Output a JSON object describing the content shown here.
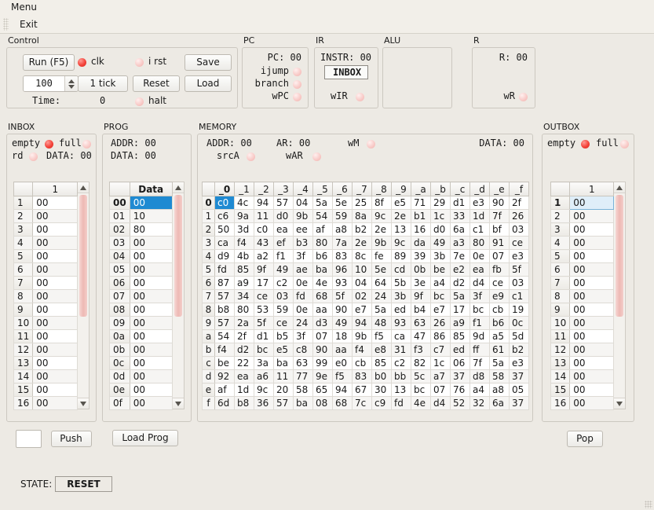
{
  "menu": {
    "items": [
      "Menu"
    ]
  },
  "toolbar": {
    "items": [
      "Exit"
    ]
  },
  "control": {
    "label": "Control",
    "run_label": "Run (F5)",
    "speed_value": "100",
    "tick_label": "1 tick",
    "reset_label": "Reset",
    "save_label": "Save",
    "load_label": "Load",
    "clk_label": "clk",
    "clk_state": "on",
    "irst_label": "i rst",
    "irst_state": "off",
    "halt_label": "halt",
    "halt_state": "off",
    "time_label": "Time:",
    "time_value": "0"
  },
  "pc": {
    "label": "PC",
    "pc_text": "PC: 00",
    "ijump_label": "ijump",
    "ijump_state": "off",
    "branch_label": "branch",
    "branch_state": "off",
    "wpc_label": "wPC",
    "wpc_state": "off"
  },
  "ir": {
    "label": "IR",
    "instr_text": "INSTR: 00",
    "instr_value": "INBOX",
    "wir_label": "wIR",
    "wir_state": "off"
  },
  "alu": {
    "label": "ALU"
  },
  "r": {
    "label": "R",
    "r_text": "R: 00",
    "wr_label": "wR",
    "wr_state": "off"
  },
  "inbox": {
    "label": "INBOX",
    "empty_label": "empty",
    "empty_state": "on",
    "full_label": "full",
    "full_state": "off",
    "rd_label": "rd",
    "rd_state": "off",
    "data_text": "DATA: 00",
    "column_header": "1",
    "rows": [
      {
        "idx": "1",
        "val": "00"
      },
      {
        "idx": "2",
        "val": "00"
      },
      {
        "idx": "3",
        "val": "00"
      },
      {
        "idx": "4",
        "val": "00"
      },
      {
        "idx": "5",
        "val": "00"
      },
      {
        "idx": "6",
        "val": "00"
      },
      {
        "idx": "7",
        "val": "00"
      },
      {
        "idx": "8",
        "val": "00"
      },
      {
        "idx": "9",
        "val": "00"
      },
      {
        "idx": "10",
        "val": "00"
      },
      {
        "idx": "11",
        "val": "00"
      },
      {
        "idx": "12",
        "val": "00"
      },
      {
        "idx": "13",
        "val": "00"
      },
      {
        "idx": "14",
        "val": "00"
      },
      {
        "idx": "15",
        "val": "00"
      },
      {
        "idx": "16",
        "val": "00"
      }
    ],
    "push_input_value": "",
    "push_label": "Push"
  },
  "prog": {
    "label": "PROG",
    "addr_text": "ADDR: 00",
    "data_text": "DATA: 00",
    "column_header": "Data",
    "rows": [
      {
        "idx": "00",
        "val": "00",
        "selected": true
      },
      {
        "idx": "01",
        "val": "10"
      },
      {
        "idx": "02",
        "val": "80"
      },
      {
        "idx": "03",
        "val": "00"
      },
      {
        "idx": "04",
        "val": "00"
      },
      {
        "idx": "05",
        "val": "00"
      },
      {
        "idx": "06",
        "val": "00"
      },
      {
        "idx": "07",
        "val": "00"
      },
      {
        "idx": "08",
        "val": "00"
      },
      {
        "idx": "09",
        "val": "00"
      },
      {
        "idx": "0a",
        "val": "00"
      },
      {
        "idx": "0b",
        "val": "00"
      },
      {
        "idx": "0c",
        "val": "00"
      },
      {
        "idx": "0d",
        "val": "00"
      },
      {
        "idx": "0e",
        "val": "00"
      },
      {
        "idx": "0f",
        "val": "00"
      }
    ],
    "load_prog_label": "Load Prog"
  },
  "memory": {
    "label": "MEMORY",
    "addr_text": "ADDR: 00",
    "ar_text": "AR: 00",
    "wm_label": "wM",
    "wm_state": "off",
    "data_text": "DATA: 00",
    "srca_label": "srcA",
    "srca_state": "off",
    "war_label": "wAR",
    "war_state": "off",
    "columns": [
      "_0",
      "_1",
      "_2",
      "_3",
      "_4",
      "_5",
      "_6",
      "_7",
      "_8",
      "_9",
      "_a",
      "_b",
      "_c",
      "_d",
      "_e",
      "_f"
    ],
    "row_headers": [
      "0",
      "1",
      "2",
      "3",
      "4",
      "5",
      "6",
      "7",
      "8",
      "9",
      "a",
      "b",
      "c",
      "d",
      "e",
      "f"
    ],
    "selected_cell": {
      "row": 0,
      "col": 0
    },
    "cells": [
      [
        "c0",
        "4c",
        "94",
        "57",
        "04",
        "5a",
        "5e",
        "25",
        "8f",
        "e5",
        "71",
        "29",
        "d1",
        "e3",
        "90",
        "2f"
      ],
      [
        "c6",
        "9a",
        "11",
        "d0",
        "9b",
        "54",
        "59",
        "8a",
        "9c",
        "2e",
        "b1",
        "1c",
        "33",
        "1d",
        "7f",
        "26"
      ],
      [
        "50",
        "3d",
        "c0",
        "ea",
        "ee",
        "af",
        "a8",
        "b2",
        "2e",
        "13",
        "16",
        "d0",
        "6a",
        "c1",
        "bf",
        "03"
      ],
      [
        "ca",
        "f4",
        "43",
        "ef",
        "b3",
        "80",
        "7a",
        "2e",
        "9b",
        "9c",
        "da",
        "49",
        "a3",
        "80",
        "91",
        "ce"
      ],
      [
        "d9",
        "4b",
        "a2",
        "f1",
        "3f",
        "b6",
        "83",
        "8c",
        "fe",
        "89",
        "39",
        "3b",
        "7e",
        "0e",
        "07",
        "e3"
      ],
      [
        "fd",
        "85",
        "9f",
        "49",
        "ae",
        "ba",
        "96",
        "10",
        "5e",
        "cd",
        "0b",
        "be",
        "e2",
        "ea",
        "fb",
        "5f"
      ],
      [
        "87",
        "a9",
        "17",
        "c2",
        "0e",
        "4e",
        "93",
        "04",
        "64",
        "5b",
        "3e",
        "a4",
        "d2",
        "d4",
        "ce",
        "03"
      ],
      [
        "57",
        "34",
        "ce",
        "03",
        "fd",
        "68",
        "5f",
        "02",
        "24",
        "3b",
        "9f",
        "bc",
        "5a",
        "3f",
        "e9",
        "c1"
      ],
      [
        "b8",
        "80",
        "53",
        "59",
        "0e",
        "aa",
        "90",
        "e7",
        "5a",
        "ed",
        "b4",
        "e7",
        "17",
        "bc",
        "cb",
        "19"
      ],
      [
        "57",
        "2a",
        "5f",
        "ce",
        "24",
        "d3",
        "49",
        "94",
        "48",
        "93",
        "63",
        "26",
        "a9",
        "f1",
        "b6",
        "0c"
      ],
      [
        "54",
        "2f",
        "d1",
        "b5",
        "3f",
        "07",
        "18",
        "9b",
        "f5",
        "ca",
        "47",
        "86",
        "85",
        "9d",
        "a5",
        "5d"
      ],
      [
        "f4",
        "d2",
        "bc",
        "e5",
        "c8",
        "90",
        "aa",
        "f4",
        "e8",
        "31",
        "f3",
        "c7",
        "ed",
        "ff",
        "61",
        "b2"
      ],
      [
        "be",
        "22",
        "3a",
        "ba",
        "63",
        "99",
        "e0",
        "cb",
        "85",
        "c2",
        "82",
        "1c",
        "06",
        "7f",
        "5a",
        "e3"
      ],
      [
        "92",
        "ea",
        "a6",
        "11",
        "77",
        "9e",
        "f5",
        "83",
        "b0",
        "bb",
        "5c",
        "a7",
        "37",
        "d8",
        "58",
        "37"
      ],
      [
        "af",
        "1d",
        "9c",
        "20",
        "58",
        "65",
        "94",
        "67",
        "30",
        "13",
        "bc",
        "07",
        "76",
        "a4",
        "a8",
        "05"
      ],
      [
        "6d",
        "b8",
        "36",
        "57",
        "ba",
        "08",
        "68",
        "7c",
        "c9",
        "fd",
        "4e",
        "d4",
        "52",
        "32",
        "6a",
        "37"
      ]
    ]
  },
  "outbox": {
    "label": "OUTBOX",
    "empty_label": "empty",
    "empty_state": "on",
    "full_label": "full",
    "full_state": "off",
    "column_header": "1",
    "rows": [
      {
        "idx": "1",
        "val": "00",
        "selected": true
      },
      {
        "idx": "2",
        "val": "00"
      },
      {
        "idx": "3",
        "val": "00"
      },
      {
        "idx": "4",
        "val": "00"
      },
      {
        "idx": "5",
        "val": "00"
      },
      {
        "idx": "6",
        "val": "00"
      },
      {
        "idx": "7",
        "val": "00"
      },
      {
        "idx": "8",
        "val": "00"
      },
      {
        "idx": "9",
        "val": "00"
      },
      {
        "idx": "10",
        "val": "00"
      },
      {
        "idx": "11",
        "val": "00"
      },
      {
        "idx": "12",
        "val": "00"
      },
      {
        "idx": "13",
        "val": "00"
      },
      {
        "idx": "14",
        "val": "00"
      },
      {
        "idx": "15",
        "val": "00"
      },
      {
        "idx": "16",
        "val": "00"
      }
    ],
    "pop_label": "Pop"
  },
  "status": {
    "state_label": "STATE:",
    "state_value": "RESET"
  },
  "colors": {
    "background": "#edeae4",
    "selection": "#1f8ad2",
    "led_on": "#f4433a",
    "led_off": "#f5c4c0"
  }
}
